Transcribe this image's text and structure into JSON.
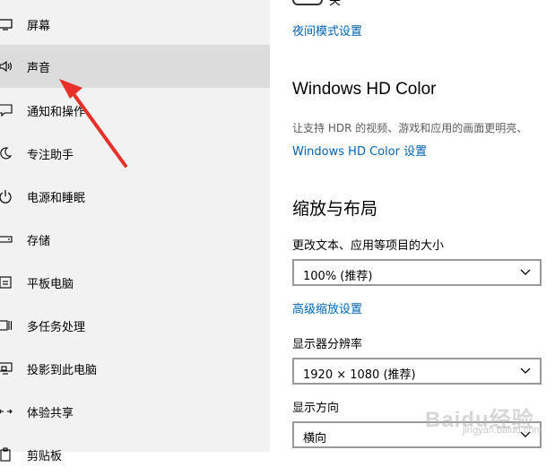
{
  "sidebar": {
    "items": [
      {
        "label": "屏幕",
        "icon": "display-icon",
        "selected": false
      },
      {
        "label": "声音",
        "icon": "speaker-icon",
        "selected": true
      },
      {
        "label": "通知和操作",
        "icon": "notification-icon",
        "selected": false
      },
      {
        "label": "专注助手",
        "icon": "moon-icon",
        "selected": false
      },
      {
        "label": "电源和睡眠",
        "icon": "power-icon",
        "selected": false
      },
      {
        "label": "存储",
        "icon": "storage-icon",
        "selected": false
      },
      {
        "label": "平板电脑",
        "icon": "tablet-icon",
        "selected": false
      },
      {
        "label": "多任务处理",
        "icon": "multitask-icon",
        "selected": false
      },
      {
        "label": "投影到此电脑",
        "icon": "project-icon",
        "selected": false
      },
      {
        "label": "体验共享",
        "icon": "share-icon",
        "selected": false
      },
      {
        "label": "剪贴板",
        "icon": "clipboard-icon",
        "selected": false
      }
    ]
  },
  "main": {
    "top_toggle_state": "关",
    "night_light_link": "夜间模式设置",
    "hd_color": {
      "title": "Windows HD Color",
      "description": "让支持 HDR 的视频、游戏和应用的画面更明亮、",
      "link": "Windows HD Color 设置"
    },
    "scale_layout": {
      "title": "缩放与布局",
      "scale_label": "更改文本、应用等项目的大小",
      "scale_value": "100% (推荐)",
      "advanced_link": "高级缩放设置",
      "resolution_label": "显示器分辨率",
      "resolution_value": "1920 × 1080 (推荐)",
      "orientation_label": "显示方向",
      "orientation_value": "横向"
    }
  },
  "annotation": {
    "arrow_color": "#e8302a"
  },
  "watermark": {
    "brand": "Baidu经验",
    "url": "jingyan.baidu.com"
  }
}
